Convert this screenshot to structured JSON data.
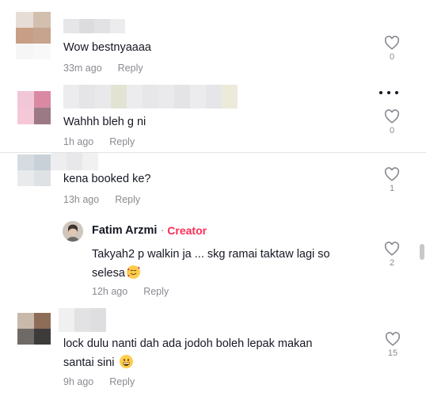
{
  "comments": [
    {
      "text": "Wow bestnyaaaa",
      "time": "33m ago",
      "reply": "Reply",
      "likes": "0"
    },
    {
      "text": "Wahhh bleh g ni",
      "time": "1h ago",
      "reply": "Reply",
      "likes": "0"
    },
    {
      "text": "kena booked ke?",
      "time": "13h ago",
      "reply": "Reply",
      "likes": "1"
    },
    {
      "text_line1": "lock dulu nanti dah ada jodoh boleh lepak makan",
      "text_line2": "santai sini",
      "time": "9h ago",
      "reply": "Reply",
      "likes": "15"
    }
  ],
  "creator_reply": {
    "name": "Fatim Arzmi",
    "separator": "·",
    "badge": "Creator",
    "text_line1": "Takyah2 p walkin ja ... skg ramai taktaw lagi so",
    "text_line2": "selesa",
    "time": "12h ago",
    "reply": "Reply",
    "likes": "2"
  },
  "icons": {
    "like": "heart-outline-icon",
    "more": "more-options-icon",
    "emoji_smiling_hearts": "smiling-face-with-hearts-emoji",
    "emoji_grin": "grinning-face-emoji"
  },
  "colors": {
    "text": "#161823",
    "muted": "#8a8b91",
    "creator_accent": "#fe2c55",
    "divider": "#e3e3e4"
  }
}
